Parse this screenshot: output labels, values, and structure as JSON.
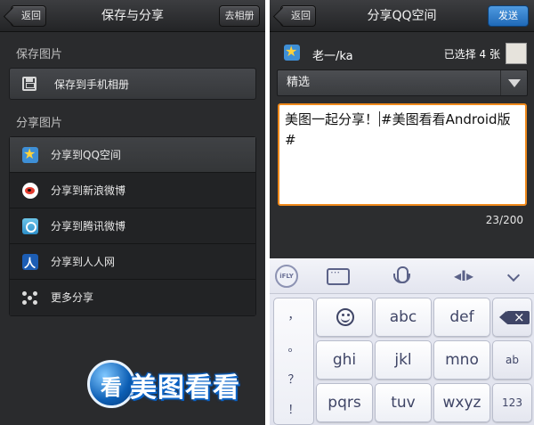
{
  "left": {
    "back_label": "返回",
    "title": "保存与分享",
    "album_button": "去相册",
    "save_section": "保存图片",
    "save_item": "保存到手机相册",
    "share_section": "分享图片",
    "share_items": [
      {
        "label": "分享到QQ空间",
        "icon": "qzone-icon"
      },
      {
        "label": "分享到新浪微博",
        "icon": "sina-weibo-icon"
      },
      {
        "label": "分享到腾讯微博",
        "icon": "tencent-weibo-icon"
      },
      {
        "label": "分享到人人网",
        "icon": "renren-icon"
      },
      {
        "label": "更多分享",
        "icon": "share-more-icon"
      }
    ],
    "logo_icon_text": "看",
    "logo_text": "美图看看"
  },
  "right": {
    "back_label": "返回",
    "title": "分享QQ空间",
    "send_label": "发送",
    "account_name": "老一/ka",
    "selected_count": "已选择 4 张",
    "album_value": "精选",
    "message_before_cursor": "美图一起分享！",
    "message_after_cursor": "#美图看看Android版#",
    "char_count": "23/200",
    "keyboard": {
      "brand_label": "iFLY",
      "punctuation": [
        "，",
        "。",
        "？",
        "！"
      ],
      "rows": [
        [
          "abc",
          "def"
        ],
        [
          "ghi",
          "jkl",
          "mno"
        ],
        [
          "pqrs",
          "tuv",
          "wxyz"
        ]
      ],
      "mode_key": "ab",
      "number_key": "123"
    }
  },
  "colors": {
    "accent_orange": "#f08a1c",
    "send_blue": "#1f69b7",
    "panel_dark": "#2a2b2d"
  }
}
